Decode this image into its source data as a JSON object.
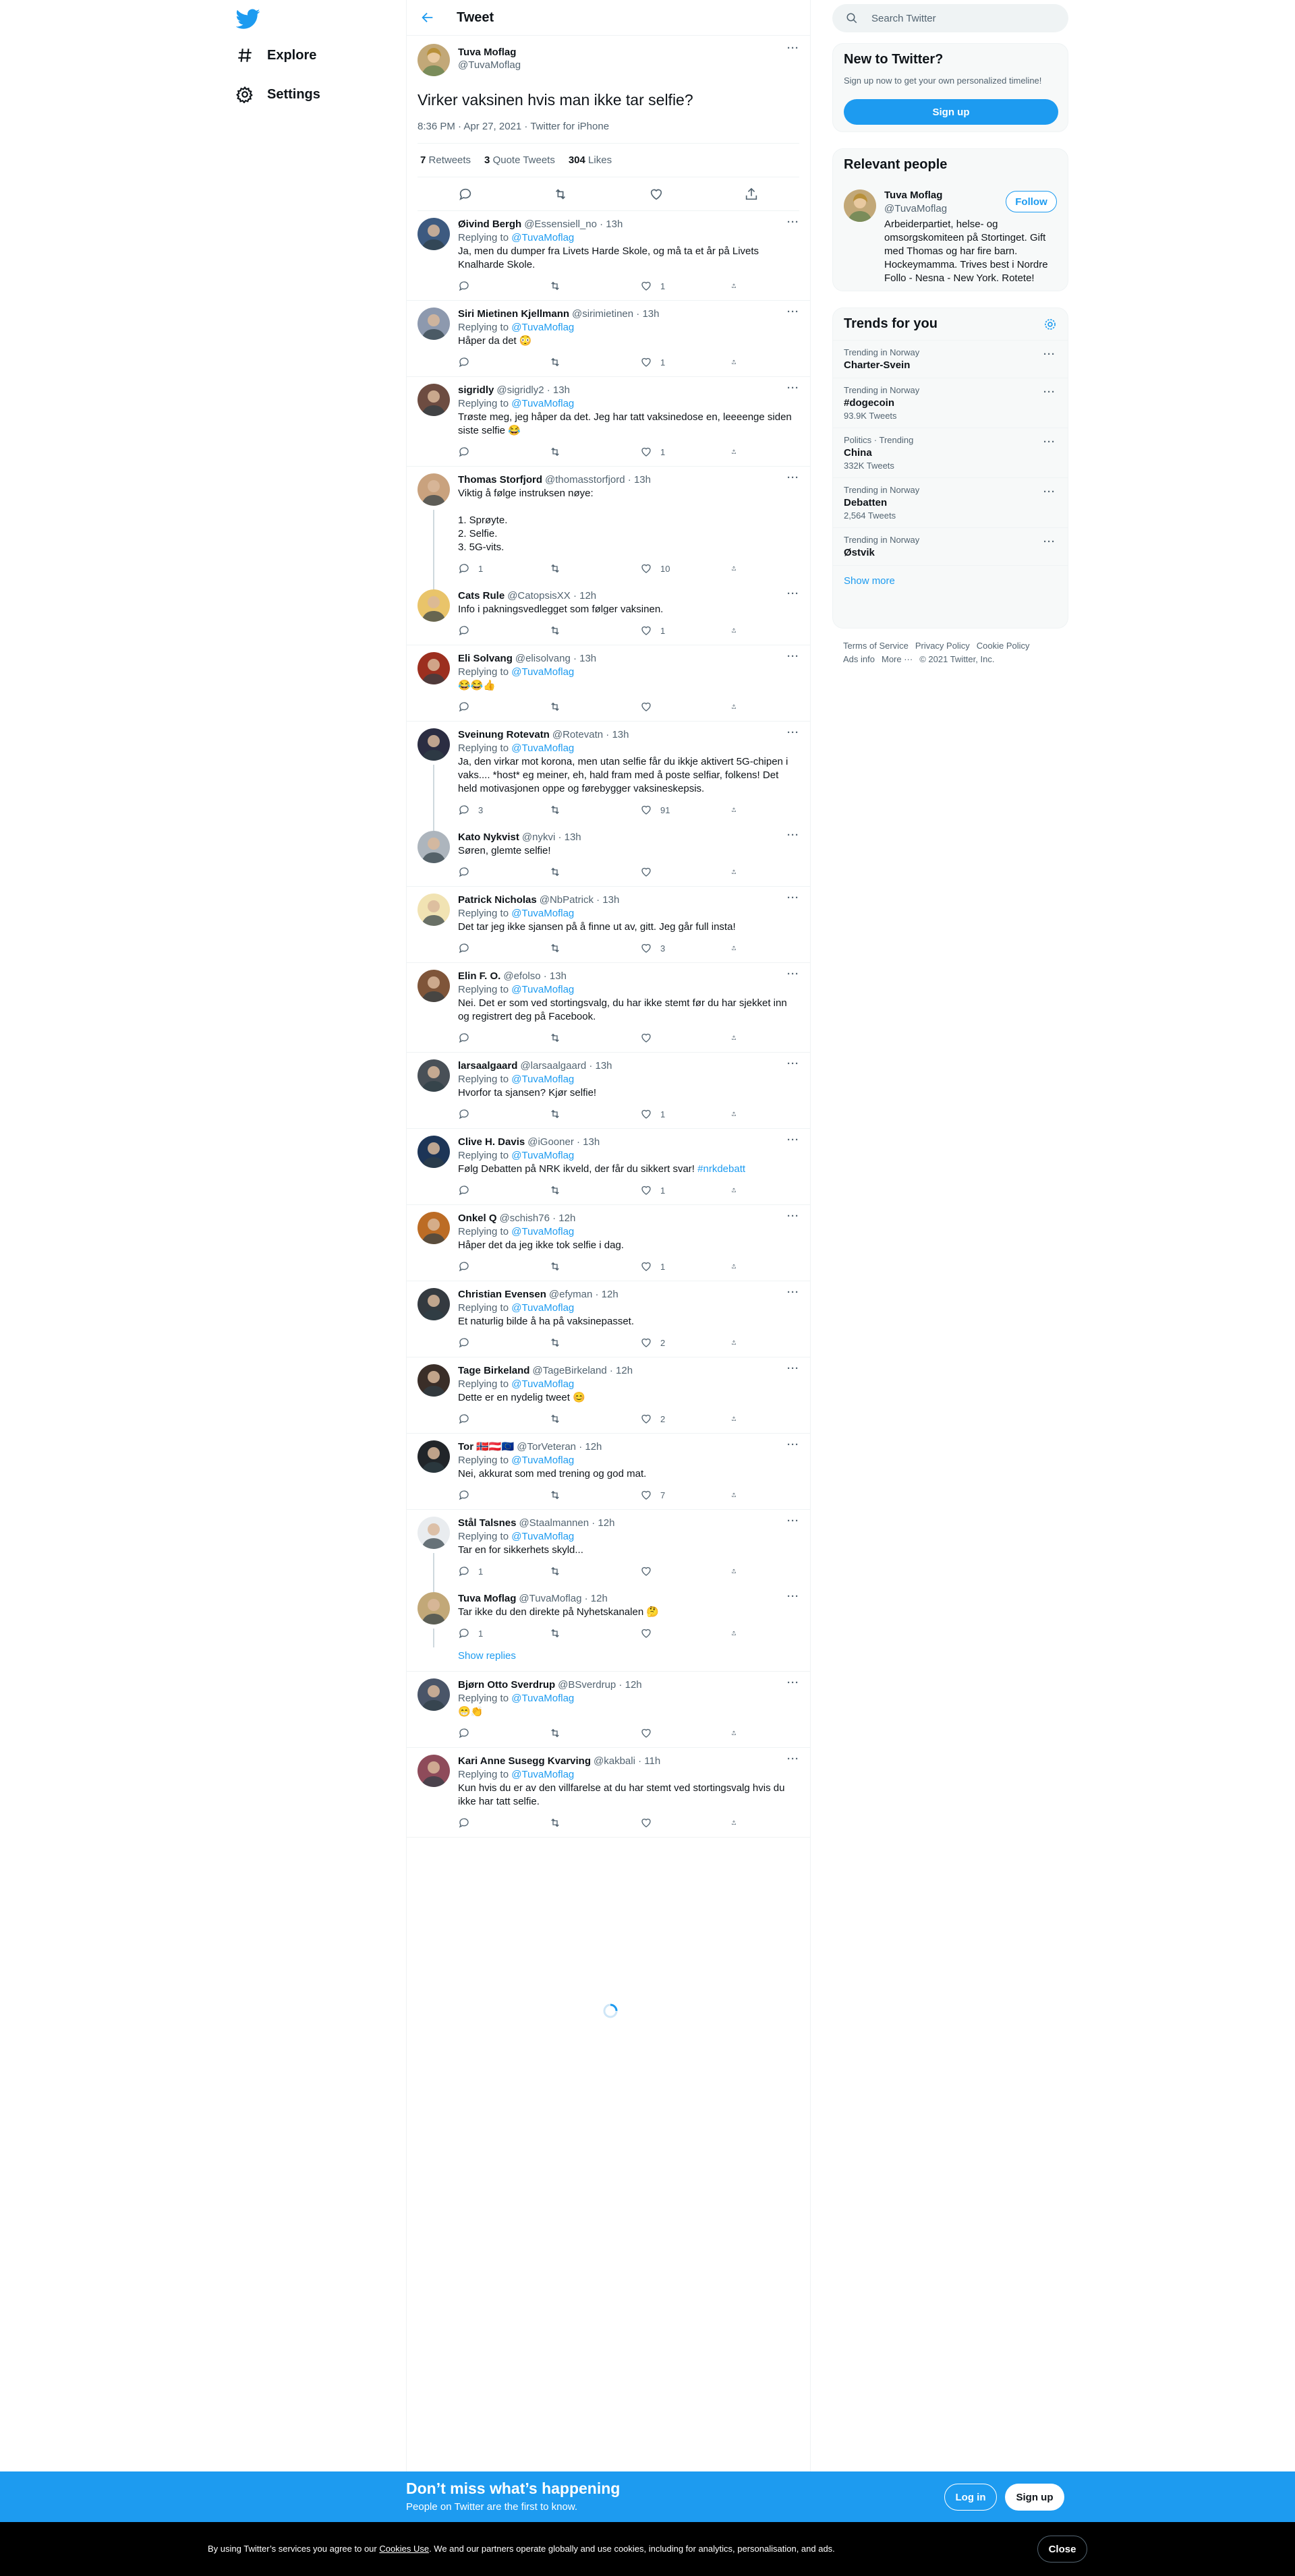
{
  "nav": {
    "explore": "Explore",
    "settings": "Settings"
  },
  "header": {
    "title": "Tweet"
  },
  "tweet": {
    "name": "Tuva Moflag",
    "handle": "@TuvaMoflag",
    "text": "Virker vaksinen hvis man ikke tar selfie?",
    "time": "8:36 PM · Apr 27, 2021",
    "source": "Twitter for iPhone",
    "retweets": "7",
    "retweets_label": "Retweets",
    "quotes": "3",
    "quotes_label": "Quote Tweets",
    "likes": "304",
    "likes_label": "Likes"
  },
  "replies": [
    {
      "name": "Øivind Bergh",
      "handle": "@Essensiell_no · 13h",
      "rt": "@TuvaMoflag",
      "text": "Ja, men du dumper fra Livets Harde Skole, og må ta et år på Livets Knalharde Skole.",
      "reply": "",
      "rts": "",
      "likes": "1",
      "av": "#3d5a80"
    },
    {
      "name": "Siri Mietinen Kjellmann",
      "handle": "@sirimietinen · 13h",
      "rt": "@TuvaMoflag",
      "text": "Håper da det 😳",
      "reply": "",
      "rts": "",
      "likes": "1",
      "av": "#8d99ae"
    },
    {
      "name": "sigridly",
      "handle": "@sigridly2 · 13h",
      "rt": "@TuvaMoflag",
      "text": "Trøste meg, jeg håper da det. Jeg har tatt vaksinedose en, leeeenge siden siste selfie 😂",
      "reply": "",
      "rts": "",
      "likes": "1",
      "av": "#6d4c41"
    },
    {
      "name": "Thomas Storfjord",
      "handle": "@thomasstorfjord · 13h",
      "rt": "",
      "text": "Viktig å følge instruksen nøye:\n\n1. Sprøyte.\n2. Selfie.\n3. 5G-vits.",
      "reply": "1",
      "rts": "",
      "likes": "10",
      "av": "#c9a27e"
    },
    {
      "name": "Cats Rule",
      "handle": "@CatopsisXX · 12h",
      "rt": "",
      "text": "Info i pakningsvedlegget som følger vaksinen.",
      "reply": "",
      "rts": "",
      "likes": "1",
      "av": "#e9c46a"
    },
    {
      "name": "Eli Solvang",
      "handle": "@elisolvang · 13h",
      "rt": "@TuvaMoflag",
      "text": "😂😂👍",
      "reply": "",
      "rts": "",
      "likes": "",
      "av": "#9c2f1f"
    },
    {
      "name": "Sveinung Rotevatn",
      "handle": "@Rotevatn · 13h",
      "rt": "@TuvaMoflag",
      "text": "Ja, den virkar mot korona, men utan selfie får du ikkje aktivert 5G-chipen i vaks.... *host* eg meiner, eh, hald fram med å poste selfiar, folkens! Det held motivasjonen oppe og førebygger vaksineskepsis.",
      "reply": "3",
      "rts": "",
      "likes": "91",
      "av": "#2b2d42"
    },
    {
      "name": "Kato Nykvist",
      "handle": "@nykvi · 13h",
      "rt": "",
      "text": "Søren, glemte selfie!",
      "reply": "",
      "rts": "",
      "likes": "",
      "av": "#adb5bd"
    },
    {
      "name": "Patrick Nicholas",
      "handle": "@NbPatrick · 13h",
      "rt": "@TuvaMoflag",
      "text": "Det tar jeg ikke sjansen på å finne ut av, gitt. Jeg går full insta!",
      "reply": "",
      "rts": "",
      "likes": "3",
      "av": "#f1e3b3"
    },
    {
      "name": "Elin F. O.",
      "handle": "@efolso · 13h",
      "rt": "@TuvaMoflag",
      "text": "Nei. Det er som ved stortingsvalg, du har ikke stemt før du har sjekket inn og registrert deg på Facebook.",
      "reply": "",
      "rts": "",
      "likes": "",
      "av": "#7f5539"
    },
    {
      "name": "larsaalgaard",
      "handle": "@larsaalgaard · 13h",
      "rt": "@TuvaMoflag",
      "text": "Hvorfor ta sjansen? Kjør selfie!",
      "reply": "",
      "rts": "",
      "likes": "1",
      "av": "#495057"
    },
    {
      "name": "Clive H. Davis",
      "handle": "@iGooner · 13h",
      "rt": "@TuvaMoflag",
      "text": "Følg Debatten på NRK ikveld, der får du sikkert svar! ",
      "tag": "#nrkdebatt",
      "reply": "",
      "rts": "",
      "likes": "1",
      "av": "#1d3557"
    },
    {
      "name": "Onkel Q",
      "handle": "@schish76 · 12h",
      "rt": "@TuvaMoflag",
      "text": "Håper det da jeg ikke tok selfie i dag.",
      "reply": "",
      "rts": "",
      "likes": "1",
      "av": "#bc6c25"
    },
    {
      "name": "Christian Evensen",
      "handle": "@efyman · 12h",
      "rt": "@TuvaMoflag",
      "text": "Et naturlig bilde å ha på vaksinepasset.",
      "reply": "",
      "rts": "",
      "likes": "2",
      "av": "#343a40"
    },
    {
      "name": "Tage Birkeland",
      "handle": "@TageBirkeland · 12h",
      "rt": "@TuvaMoflag",
      "text": "Dette er en nydelig tweet 😊",
      "reply": "",
      "rts": "",
      "likes": "2",
      "av": "#3a2e28"
    },
    {
      "name": "Tor 🇳🇴🇦🇹🇪🇺",
      "handle": "@TorVeteran · 12h",
      "rt": "@TuvaMoflag",
      "text": "Nei, akkurat som med trening og god mat.",
      "reply": "",
      "rts": "",
      "likes": "7",
      "av": "#212529"
    },
    {
      "name": "Stål Talsnes",
      "handle": "@Staalmannen · 12h",
      "rt": "@TuvaMoflag",
      "text": "Tar en for sikkerhets skyld...",
      "reply": "1",
      "rts": "",
      "likes": "",
      "av": "#e9ecef"
    },
    {
      "name": "Tuva Moflag",
      "handle": "@TuvaMoflag · 12h",
      "rt": "",
      "text": "Tar ikke du den direkte på Nyhetskanalen 🤔",
      "reply": "1",
      "rts": "",
      "likes": "",
      "av": "#c2a878"
    },
    {
      "name": "Bjørn Otto Sverdrup",
      "handle": "@BSverdrup · 12h",
      "rt": "@TuvaMoflag",
      "text": "😁👏",
      "reply": "",
      "rts": "",
      "likes": "",
      "av": "#4a5568"
    },
    {
      "name": "Kari Anne Susegg Kvarving",
      "handle": "@kakbali · 11h",
      "rt": "@TuvaMoflag",
      "text": "Kun hvis du er av den villfarelse at du har stemt ved stortingsvalg hvis du ikke har tatt selfie.",
      "reply": "",
      "rts": "",
      "likes": "",
      "av": "#8e4b5a"
    }
  ],
  "replying_to": "Replying to",
  "show_replies": "Show replies",
  "search": {
    "placeholder": "Search Twitter"
  },
  "new_to_twitter": {
    "title": "New to Twitter?",
    "sub": "Sign up now to get your own personalized timeline!",
    "button": "Sign up"
  },
  "relevant": {
    "title": "Relevant people",
    "name": "Tuva Moflag",
    "handle": "@TuvaMoflag",
    "bio": "Arbeiderpartiet, helse- og omsorgskomiteen på Stortinget. Gift med Thomas og har fire barn. Hockeymamma. Trives best i Nordre Follo - Nesna - New York. Rotete!",
    "button": "Follow"
  },
  "trends": {
    "title": "Trends for you",
    "items": [
      {
        "meta": "Trending in Norway",
        "title": "Charter-Svein",
        "count": ""
      },
      {
        "meta": "Trending in Norway",
        "title": "#dogecoin",
        "count": "93.9K Tweets"
      },
      {
        "meta": "Politics · Trending",
        "title": "China",
        "count": "332K Tweets"
      },
      {
        "meta": "Trending in Norway",
        "title": "Debatten",
        "count": "2,564 Tweets"
      },
      {
        "meta": "Trending in Norway",
        "title": "Østvik",
        "count": ""
      }
    ],
    "show_more": "Show more"
  },
  "footer": {
    "terms": "Terms of Service",
    "privacy": "Privacy Policy",
    "cookie": "Cookie Policy",
    "ads": "Ads info",
    "more": "More ···",
    "copy": "© 2021 Twitter, Inc."
  },
  "bottom": {
    "title": "Don’t miss what’s happening",
    "sub": "People on Twitter are the first to know.",
    "login": "Log in",
    "signup": "Sign up"
  },
  "cookie": {
    "pre": "By using Twitter’s services you agree to our ",
    "link": "Cookies Use",
    "post": ". We and our partners operate globally and use cookies, including for analytics, personalisation, and ads.",
    "close": "Close"
  },
  "colors": {
    "accent": "#1d9bf0",
    "bottombar": "#1d9bf0",
    "cookiebar": "#000000"
  }
}
